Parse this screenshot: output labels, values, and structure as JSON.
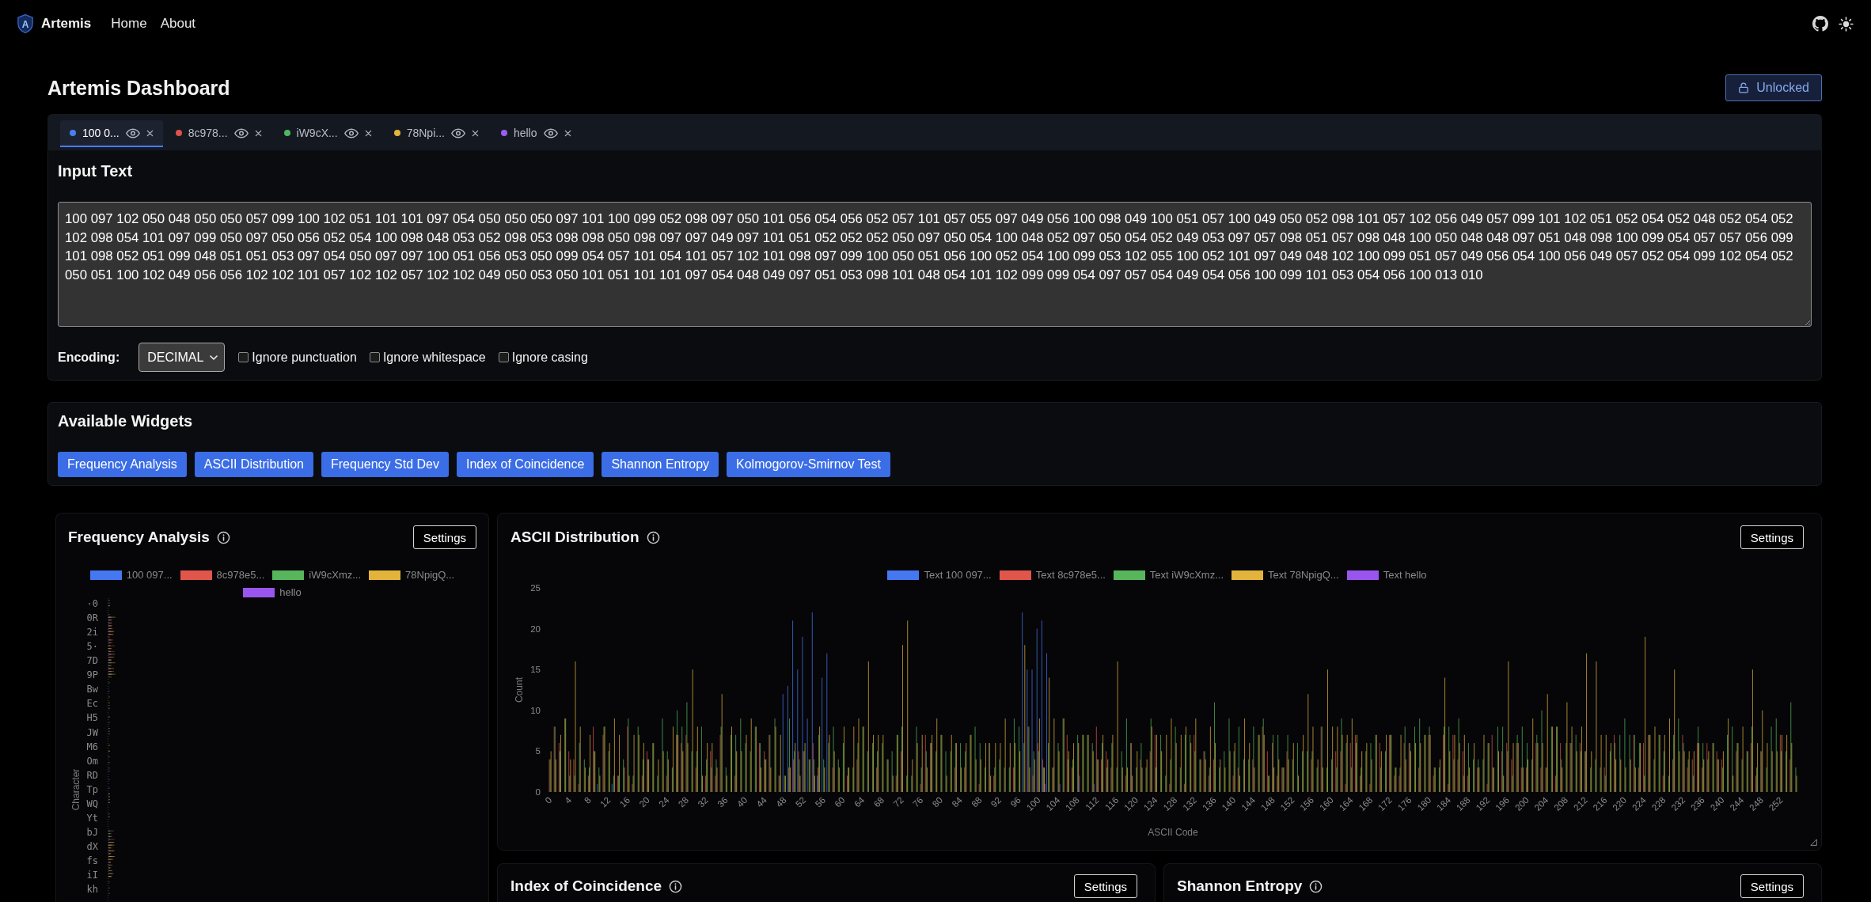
{
  "nav": {
    "logo_mark": "A",
    "brand": "Artemis",
    "links": [
      "Home",
      "About"
    ]
  },
  "header": {
    "title": "Artemis Dashboard",
    "lock_label": "Unlocked"
  },
  "tabs": [
    {
      "label": "100 0...",
      "color": "#4a7ff0",
      "selected": true
    },
    {
      "label": "8c978...",
      "color": "#e0524a",
      "selected": false
    },
    {
      "label": "iW9cX...",
      "color": "#4fb860",
      "selected": false
    },
    {
      "label": "78Npi...",
      "color": "#e3b43a",
      "selected": false
    },
    {
      "label": "hello",
      "color": "#9b5cf5",
      "selected": false
    }
  ],
  "input_panel": {
    "heading": "Input Text",
    "text": "100 097 102 050 048 050 050 057 099 100 102 051 101 101 097 054 050 050 050 097 101 100 099 052 098 097 050 101 056 054 056 052 057 101 057 055 097 049 056 100 098 049 100 051 057 100 049 050 052 098 101 057 102 056 049 057 099 101 102 051 052 054 052 048 052 054 052 102 098 054 101 097 099 050 097 050 056 052 054 100 098 048 053 052 098 053 098 098 050 098 097 097 049 097 101 051 052 052 052 050 097 050 054 100 048 052 097 050 054 052 049 053 097 057 098 051 057 098 048 100 050 048 048 097 051 048 098 100 099 054 057 057 056 099 101 098 052 051 099 048 051 051 053 097 054 050 097 097 100 051 056 053 050 099 054 057 101 054 101 057 102 101 098 097 099 100 050 051 056 100 052 054 100 099 053 102 055 100 052 101 097 049 048 102 100 099 051 057 049 056 054 100 056 049 057 052 054 099 102 054 052 050 051 100 102 049 056 056 102 102 101 057 102 102 057 102 102 049 050 053 050 101 051 101 101 097 054 048 049 097 051 053 098 101 048 054 101 102 099 099 054 097 057 054 049 054 056 100 099 101 053 054 056 100 013 010",
    "encoding_label": "Encoding:",
    "encoding": "DECIMAL",
    "options": [
      {
        "label": "Ignore punctuation",
        "checked": false
      },
      {
        "label": "Ignore whitespace",
        "checked": false
      },
      {
        "label": "Ignore casing",
        "checked": false
      }
    ]
  },
  "widget_palette": {
    "heading": "Available Widgets",
    "buttons": [
      "Frequency Analysis",
      "ASCII Distribution",
      "Frequency Std Dev",
      "Index of Coincidence",
      "Shannon Entropy",
      "Kolmogorov-Smirnov Test"
    ]
  },
  "widgets": [
    {
      "kind": "horizontal_bars",
      "title": "Frequency Analysis",
      "settings": "Settings",
      "legend": [
        {
          "label": "100 097...",
          "color": "#4577f0"
        },
        {
          "label": "8c978e5...",
          "color": "#e0564b"
        },
        {
          "label": "iW9cXmz...",
          "color": "#57b65c"
        },
        {
          "label": "78NpigQ...",
          "color": "#e3b43c"
        },
        {
          "label": "hello",
          "color": "#9a55ef"
        }
      ],
      "y_title": "Character",
      "y_labels": [
        "·0",
        "0R",
        "2i",
        "5·",
        "7D",
        "9P",
        "Bw",
        "Ec",
        "H5",
        "JW",
        "M6",
        "Om",
        "RD",
        "Tp",
        "WQ",
        "Yt",
        "bJ",
        "dX",
        "fs",
        "iI",
        "kh"
      ]
    },
    {
      "kind": "histogram",
      "title": "ASCII Distribution",
      "settings": "Settings",
      "legend": [
        {
          "label": "Text 100 097...",
          "color": "#4577f0"
        },
        {
          "label": "Text 8c978e5...",
          "color": "#e0564b"
        },
        {
          "label": "Text iW9cXmz...",
          "color": "#57b65c"
        },
        {
          "label": "Text 78NpigQ...",
          "color": "#e3b43c"
        },
        {
          "label": "Text hello",
          "color": "#9a55ef"
        }
      ],
      "y_title": "Count",
      "y_ticks": [
        "25",
        "20",
        "15",
        "10",
        "5",
        "0"
      ],
      "x_title": "ASCII Code",
      "x_ticks": [
        "0",
        "4",
        "8",
        "12",
        "16",
        "20",
        "24",
        "28",
        "32",
        "36",
        "40",
        "44",
        "48",
        "52",
        "56",
        "60",
        "64",
        "68",
        "72",
        "76",
        "80",
        "84",
        "88",
        "92",
        "96",
        "100",
        "104",
        "108",
        "112",
        "116",
        "120",
        "124",
        "128",
        "132",
        "136",
        "140",
        "144",
        "148",
        "152",
        "156",
        "160",
        "164",
        "168",
        "172",
        "176",
        "180",
        "184",
        "188",
        "192",
        "196",
        "200",
        "204",
        "208",
        "212",
        "216",
        "220",
        "224",
        "228",
        "232",
        "236",
        "240",
        "244",
        "248",
        "252"
      ]
    },
    {
      "kind": "score",
      "title": "Index of Coincidence",
      "settings": "Settings"
    },
    {
      "kind": "score",
      "title": "Shannon Entropy",
      "settings": "Settings"
    }
  ]
}
